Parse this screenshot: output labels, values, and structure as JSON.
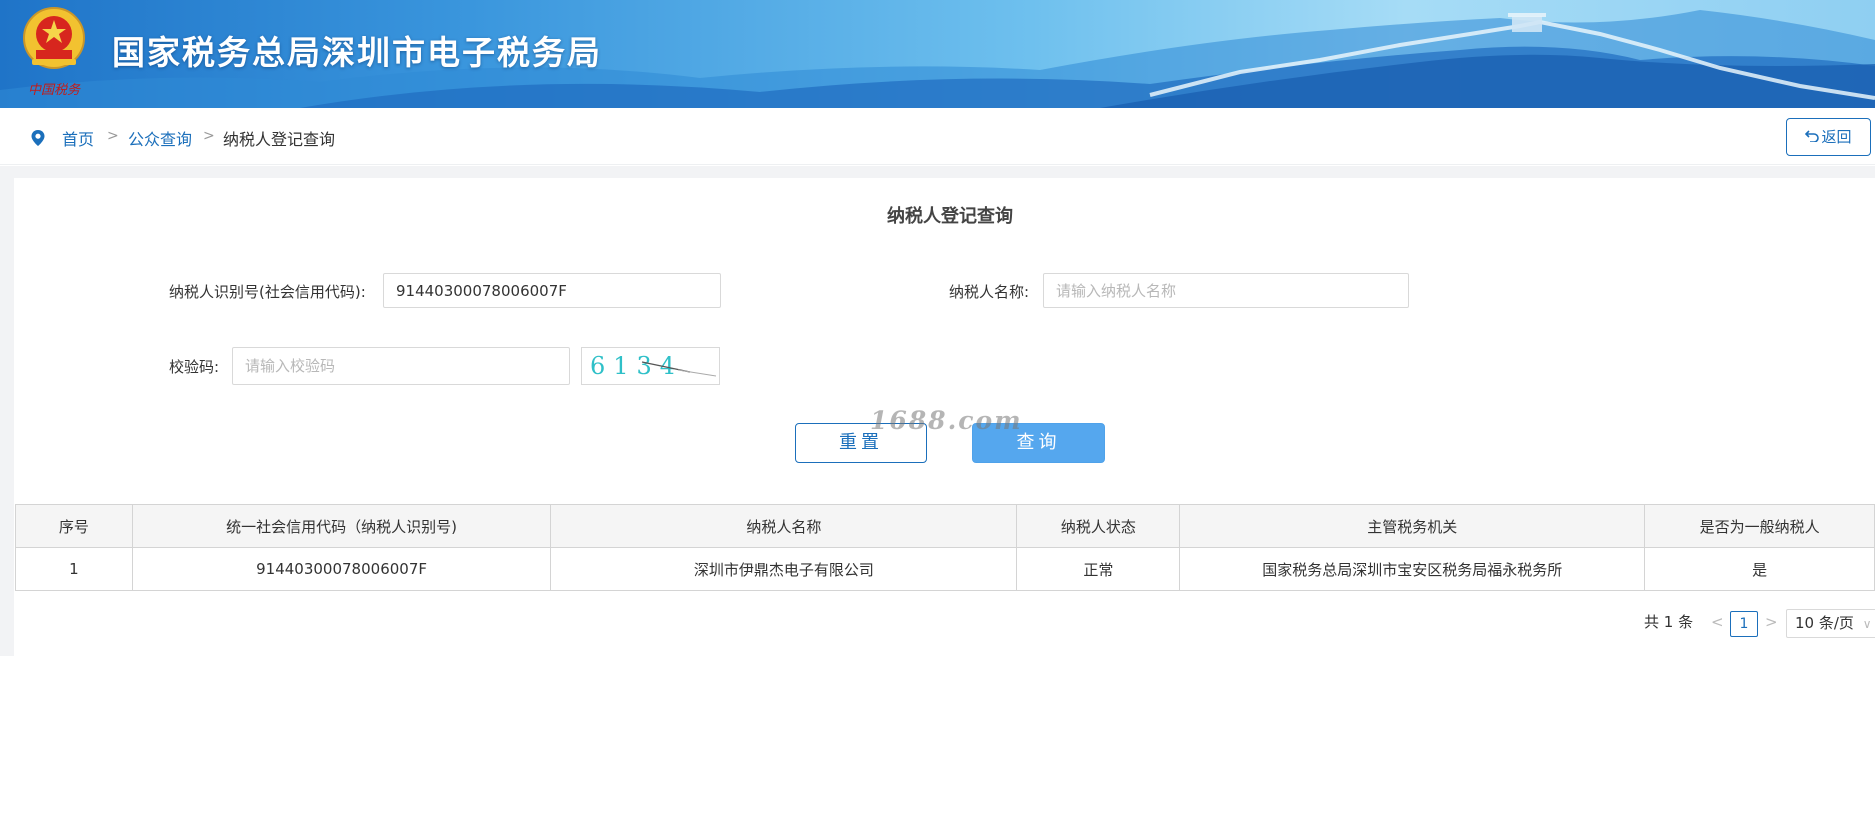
{
  "header": {
    "emblem_caption": "中国税务",
    "site_title": "国家税务总局深圳市电子税务局"
  },
  "breadcrumb": {
    "items": [
      {
        "label": "首页"
      },
      {
        "label": "公众查询"
      },
      {
        "label": "纳税人登记查询"
      }
    ],
    "separator": ">"
  },
  "back_button": {
    "label": "返回",
    "icon": "undo-arrow-icon"
  },
  "form": {
    "title": "纳税人登记查询",
    "taxpayer_id": {
      "label": "纳税人识别号(社会信用代码):",
      "value": "91440300078006007F"
    },
    "taxpayer_name": {
      "label": "纳税人名称:",
      "placeholder": "请输入纳税人名称",
      "value": ""
    },
    "captcha": {
      "label": "校验码:",
      "placeholder": "请输入校验码",
      "value": "",
      "image_text": "6134"
    },
    "reset_label": "重置",
    "query_label": "查询"
  },
  "watermark": "1688.com",
  "table": {
    "columns": [
      "序号",
      "统一社会信用代码（纳税人识别号)",
      "纳税人名称",
      "纳税人状态",
      "主管税务机关",
      "是否为一般纳税人"
    ],
    "rows": [
      [
        "1",
        "91440300078006007F",
        "深圳市伊鼎杰电子有限公司",
        "正常",
        "国家税务总局深圳市宝安区税务局福永税务所",
        "是"
      ]
    ]
  },
  "pagination": {
    "total_label": "共 1 条",
    "current_page": "1",
    "page_size_label": "10 条/页"
  },
  "colors": {
    "link_blue": "#1b6fbb",
    "query_button": "#55a7ee",
    "banner_start": "#1f74c8",
    "banner_end": "#a6dcf6"
  }
}
